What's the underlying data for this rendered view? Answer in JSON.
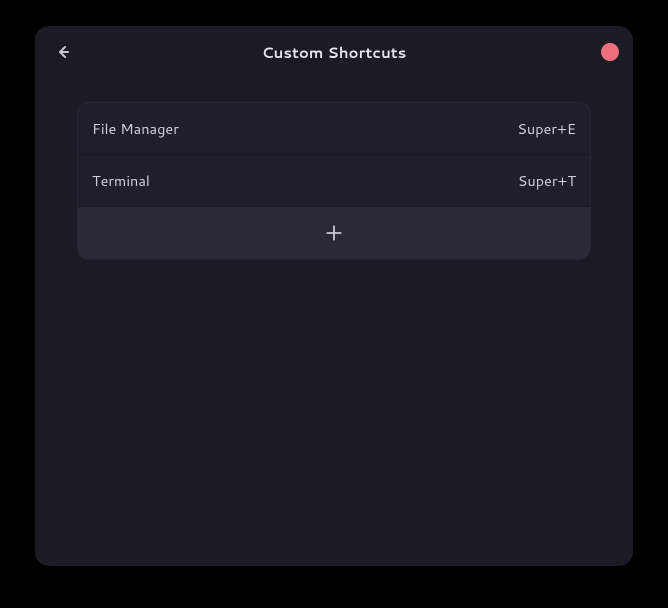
{
  "header": {
    "title": "Custom Shortcuts"
  },
  "shortcuts": [
    {
      "label": "File Manager",
      "binding": "Super+E"
    },
    {
      "label": "Terminal",
      "binding": "Super+T"
    }
  ]
}
